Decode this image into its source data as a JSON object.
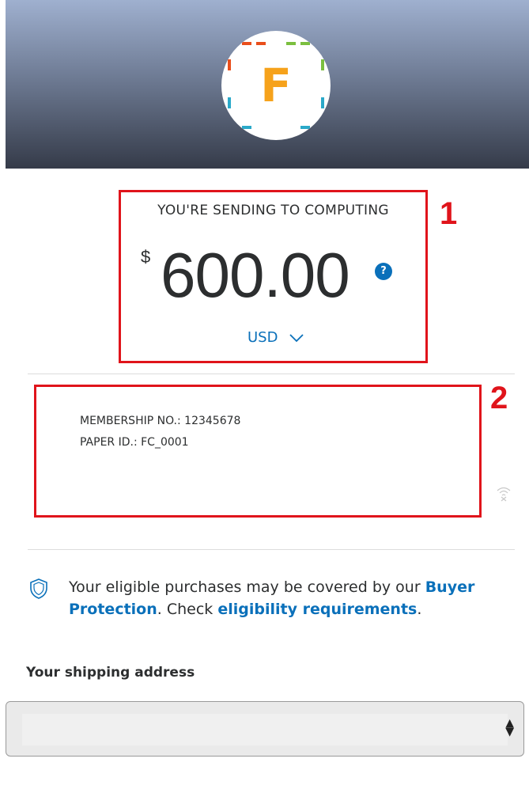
{
  "header": {
    "logo_letter": "F",
    "logo_colors": [
      "#e94e1b",
      "#7bbf3f",
      "#2aa9c9",
      "#f6a21b"
    ]
  },
  "payment": {
    "sending_label": "YOU'RE SENDING TO COMPUTING",
    "currency_symbol": "$",
    "amount": "600.00",
    "help_icon": "?",
    "currency": "USD"
  },
  "annotations": {
    "box1_label": "1",
    "box2_label": "2",
    "color": "#e0141b"
  },
  "note": {
    "line1": "MEMBERSHIP NO.: 12345678",
    "line2": "PAPER ID.: FC_0001"
  },
  "protection": {
    "text_before": "Your eligible purchases may be covered by our ",
    "link1": "Buyer Protection",
    "text_middle": ". Check ",
    "link2": "eligibility requirements",
    "text_after": "."
  },
  "shipping": {
    "title": "Your shipping address",
    "selected_value": ""
  },
  "colors": {
    "link": "#0a70ba",
    "text": "#2c2e2f"
  }
}
